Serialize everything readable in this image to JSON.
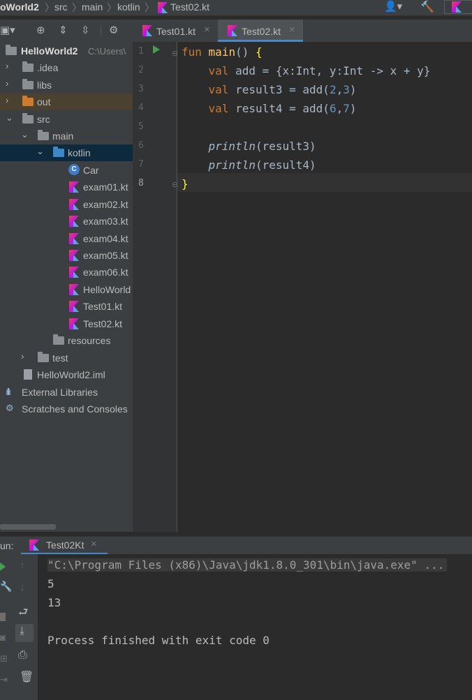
{
  "navbar": {
    "crumbs": [
      "oWorld2",
      "src",
      "main",
      "kotlin",
      "Test02.kt"
    ]
  },
  "project": {
    "root_name": "HelloWorld2",
    "root_path": "C:\\Users\\",
    "items": [
      {
        "label": ".idea"
      },
      {
        "label": "libs"
      },
      {
        "label": "out"
      },
      {
        "label": "src"
      },
      {
        "label": "main"
      },
      {
        "label": "kotlin"
      },
      {
        "label": "Car"
      },
      {
        "label": "exam01.kt"
      },
      {
        "label": "exam02.kt"
      },
      {
        "label": "exam03.kt"
      },
      {
        "label": "exam04.kt"
      },
      {
        "label": "exam05.kt"
      },
      {
        "label": "exam06.kt"
      },
      {
        "label": "HelloWorld"
      },
      {
        "label": "Test01.kt"
      },
      {
        "label": "Test02.kt"
      },
      {
        "label": "resources"
      },
      {
        "label": "test"
      },
      {
        "label": "HelloWorld2.iml"
      },
      {
        "label": "External Libraries"
      },
      {
        "label": "Scratches and Consoles"
      }
    ]
  },
  "tabs": [
    {
      "label": "Test01.kt",
      "active": false
    },
    {
      "label": "Test02.kt",
      "active": true
    }
  ],
  "editor": {
    "line_numbers": [
      "1",
      "2",
      "3",
      "4",
      "5",
      "6",
      "7",
      "8"
    ],
    "current_line": 8,
    "lines": [
      "fun main() {",
      "    val add = {x:Int, y:Int -> x + y}",
      "    val result3 = add(2,3)",
      "    val result4 = add(6,7)",
      "",
      "    println(result3)",
      "    println(result4)",
      "}"
    ]
  },
  "run": {
    "label": "un:",
    "tab_label": "Test02Kt",
    "output": [
      "\"C:\\Program Files (x86)\\Java\\jdk1.8.0_301\\bin\\java.exe\" ...",
      "5",
      "13",
      "",
      "Process finished with exit code 0"
    ]
  },
  "colors": {
    "keyword": "#cc7832",
    "function": "#ffc66d",
    "number": "#6897bb",
    "text": "#a9b7c6",
    "selection": "#0d293e",
    "accent": "#4a88c7"
  }
}
